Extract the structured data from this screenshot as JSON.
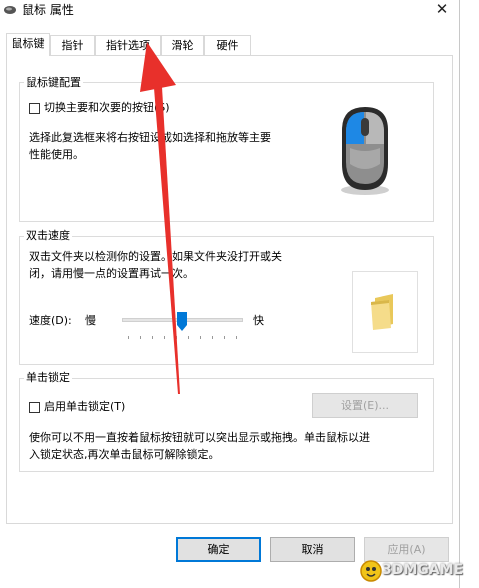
{
  "window": {
    "title": "鼠标 属性",
    "close_glyph": "✕"
  },
  "tabs": [
    {
      "label": "鼠标键",
      "active": true
    },
    {
      "label": "指针",
      "active": false
    },
    {
      "label": "指针选项",
      "active": false
    },
    {
      "label": "滑轮",
      "active": false
    },
    {
      "label": "硬件",
      "active": false
    }
  ],
  "button_config": {
    "title": "鼠标键配置",
    "checkbox_label": "切换主要和次要的按钮(S)",
    "checked": false,
    "description_line1": "选择此复选框来将右按钮设成如选择和拖放等主要",
    "description_line2": "性能使用。"
  },
  "double_click": {
    "title": "双击速度",
    "description_line1": "双击文件夹以检测你的设置。如果文件夹没打开或关",
    "description_line2": "闭，请用慢一点的设置再试一次。",
    "speed_label": "速度(D):",
    "slow_label": "慢",
    "fast_label": "快",
    "speed_level": 0.5
  },
  "click_lock": {
    "title": "单击锁定",
    "checkbox_label": "启用单击锁定(T)",
    "checked": false,
    "settings_button": "设置(E)...",
    "description_line1": "使你可以不用一直按着鼠标按钮就可以突出显示或拖拽。单击鼠标以进",
    "description_line2": "入锁定状态,再次单击鼠标可解除锁定。"
  },
  "footer": {
    "ok": "确定",
    "cancel": "取消",
    "apply": "应用(A)"
  },
  "watermark": {
    "text": "3DMGAME"
  },
  "colors": {
    "arrow": "#e8302b",
    "mouse_accent": "#1e88e5",
    "focus_border": "#0078d7"
  }
}
